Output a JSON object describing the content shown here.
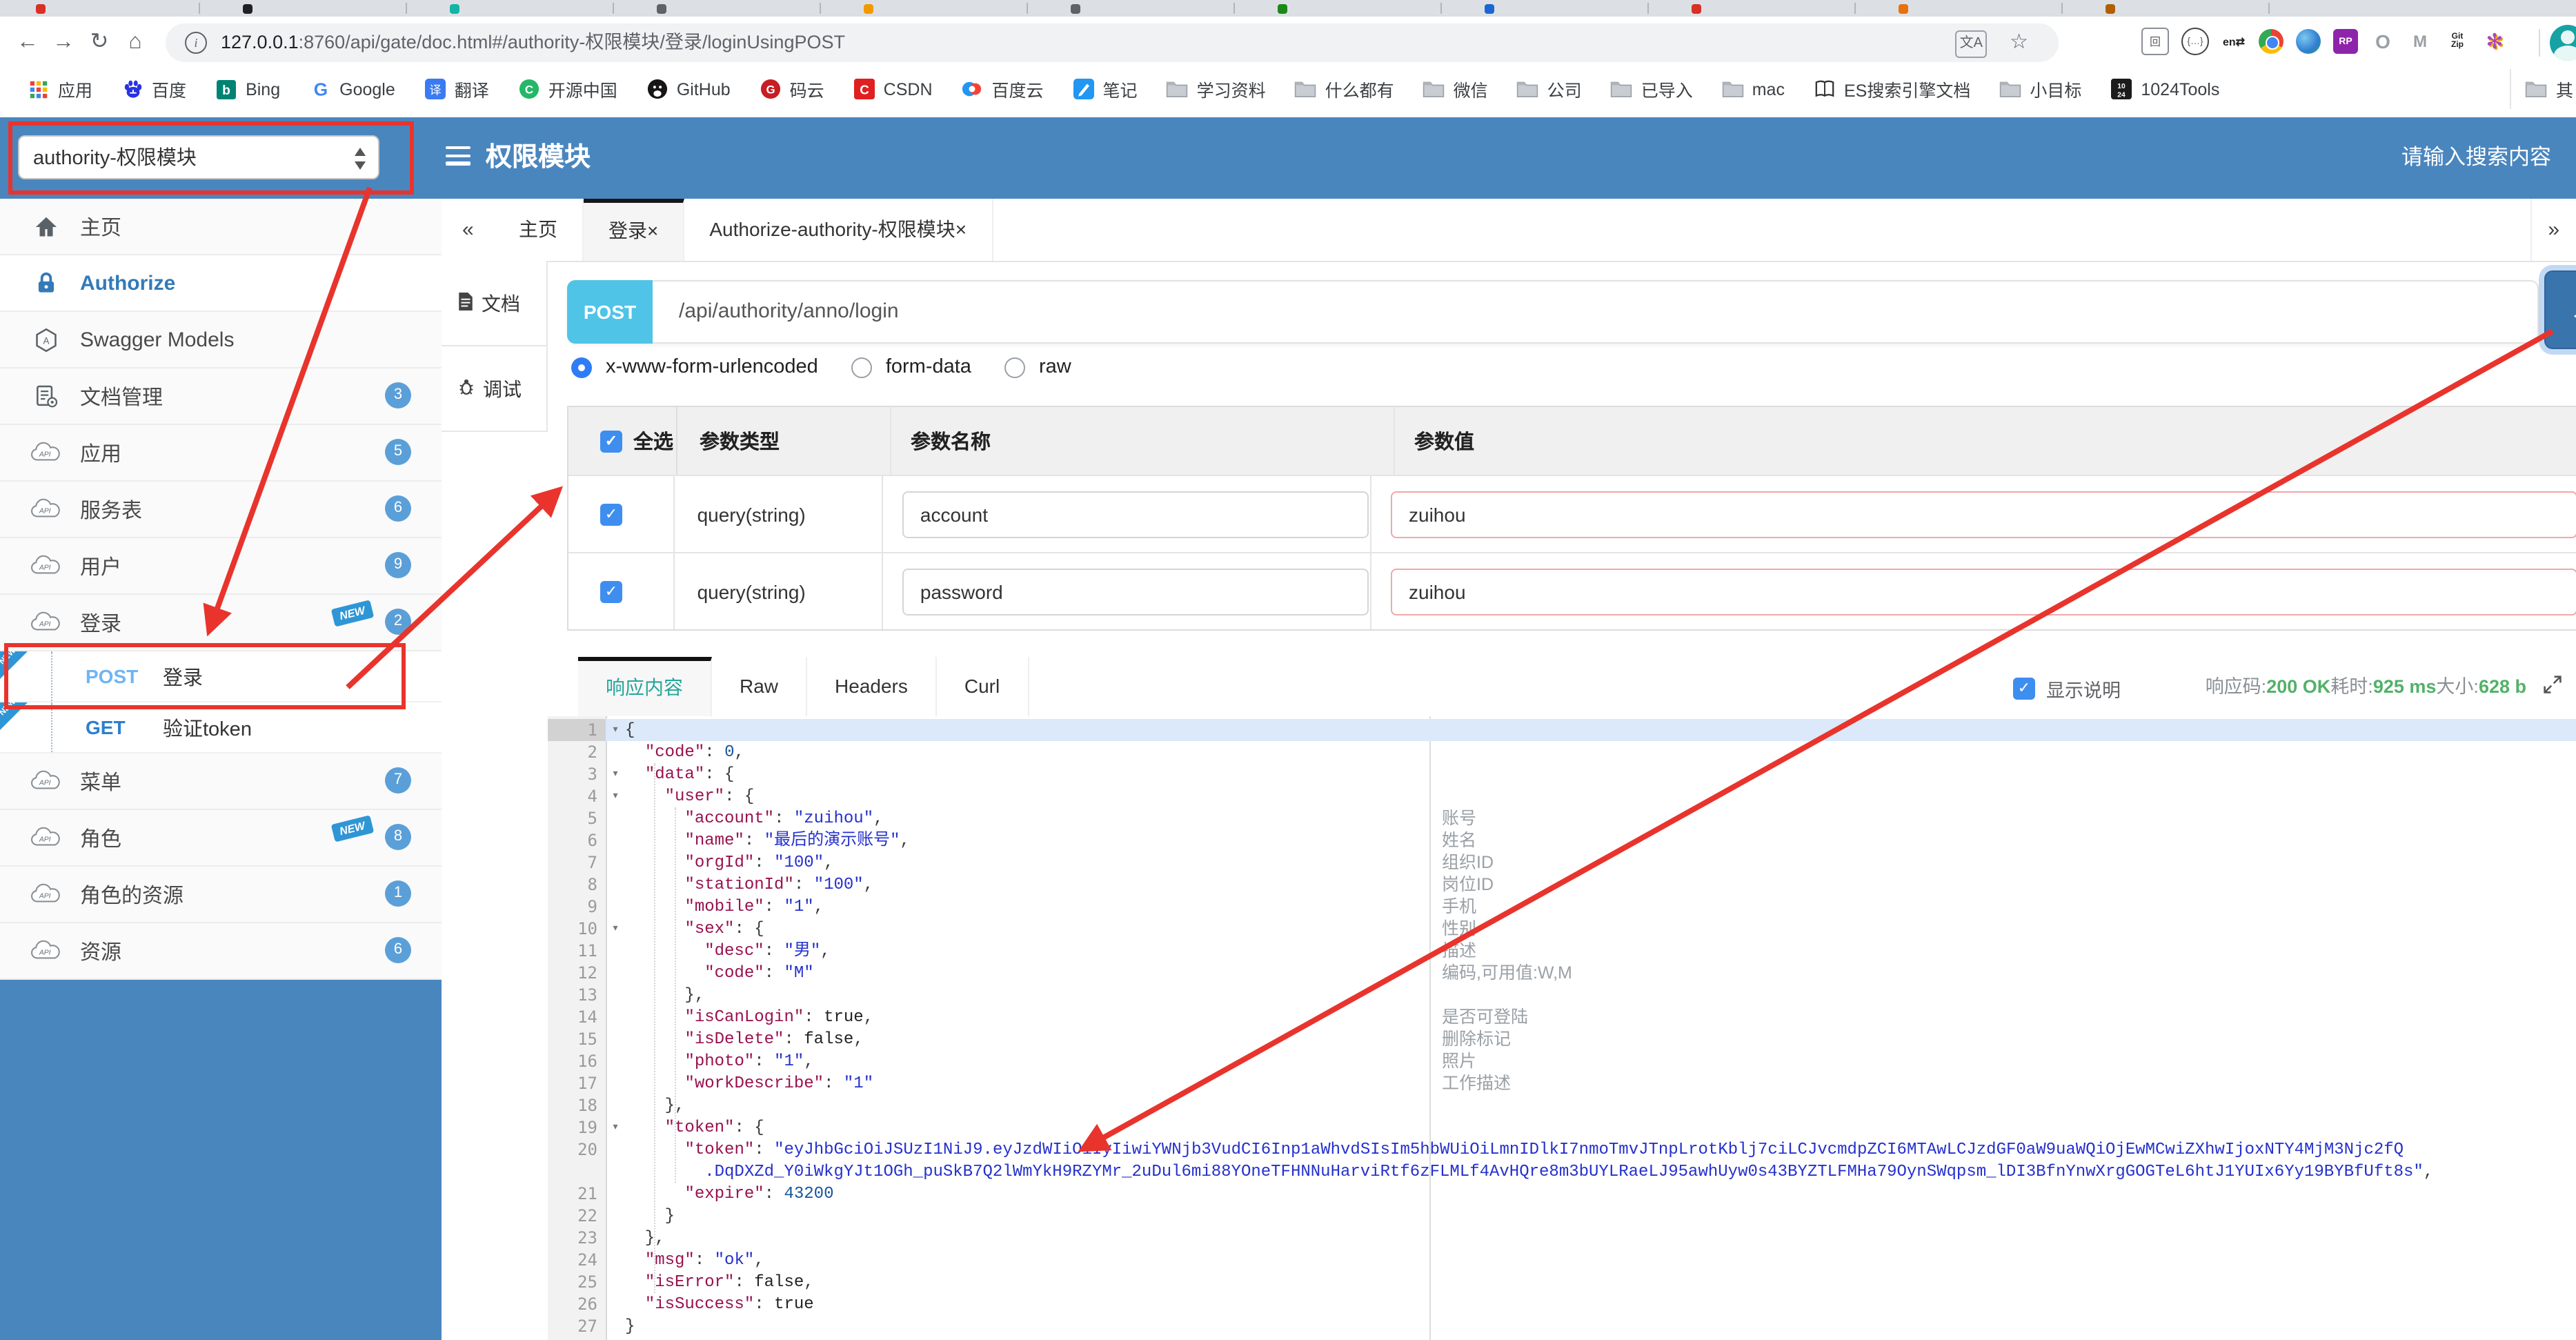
{
  "browser": {
    "tab_favicons": [
      "#d93025",
      "#202124",
      "#12b5a5",
      "#5f6368",
      "#f29900",
      "#5f6368",
      "#1a8917",
      "#1967d2",
      "#d93025",
      "#e8710a",
      "#b06000"
    ],
    "toolbar": {
      "back": "←",
      "forward": "→",
      "reload": "↻",
      "home": "⌂",
      "info": "i",
      "star": "☆",
      "translate": "文A",
      "url_host": "127.0.0.1",
      "url_rest": ":8760/api/gate/doc.html#/authority-权限模块/登录/loginUsingPOST"
    },
    "extensions": [
      "page",
      "braces",
      "en",
      "chrome",
      "globe",
      "rp",
      "o",
      "m",
      "gitzip",
      "asterisk"
    ],
    "bookmarks": [
      {
        "label": "应用",
        "icon": "apps"
      },
      {
        "label": "百度",
        "icon": "baidu"
      },
      {
        "label": "Bing",
        "icon": "bing"
      },
      {
        "label": "Google",
        "icon": "google"
      },
      {
        "label": "翻译",
        "icon": "translate"
      },
      {
        "label": "开源中国",
        "icon": "oschina"
      },
      {
        "label": "GitHub",
        "icon": "github"
      },
      {
        "label": "码云",
        "icon": "gitee"
      },
      {
        "label": "CSDN",
        "icon": "csdn"
      },
      {
        "label": "百度云",
        "icon": "baiduyun"
      },
      {
        "label": "笔记",
        "icon": "note"
      },
      {
        "label": "学习资料",
        "icon": "folder"
      },
      {
        "label": "什么都有",
        "icon": "folder"
      },
      {
        "label": "微信",
        "icon": "folder"
      },
      {
        "label": "公司",
        "icon": "folder"
      },
      {
        "label": "已导入",
        "icon": "folder"
      },
      {
        "label": "mac",
        "icon": "folder"
      },
      {
        "label": "ES搜索引擎文档",
        "icon": "book"
      },
      {
        "label": "小目标",
        "icon": "folder"
      },
      {
        "label": "1024Tools",
        "icon": "tools1024"
      }
    ],
    "bookmarks_overflow": "其"
  },
  "app": {
    "module_select": "authority-权限模块",
    "title": "权限模块",
    "search_placeholder": "请输入搜索内容"
  },
  "sidebar": {
    "items": [
      {
        "label": "主页",
        "icon": "home"
      },
      {
        "label": "Authorize",
        "icon": "lock",
        "accent": true
      },
      {
        "label": "Swagger Models",
        "icon": "models"
      },
      {
        "label": "文档管理",
        "icon": "docs",
        "badge": "3"
      },
      {
        "label": "应用",
        "icon": "api",
        "badge": "5"
      },
      {
        "label": "服务表",
        "icon": "api",
        "badge": "6"
      },
      {
        "label": "用户",
        "icon": "api",
        "badge": "9"
      },
      {
        "label": "登录",
        "icon": "api",
        "badge": "2",
        "tag": "NEW"
      },
      {
        "kind": "child",
        "method": "POST",
        "label": "登录",
        "ribbon": "NEW"
      },
      {
        "kind": "child",
        "method": "GET",
        "label": "验证token",
        "ribbon": "NEW"
      },
      {
        "label": "菜单",
        "icon": "api",
        "badge": "7"
      },
      {
        "label": "角色",
        "icon": "api",
        "badge": "8",
        "tag": "NEW"
      },
      {
        "label": "角色的资源",
        "icon": "api",
        "badge": "1"
      },
      {
        "label": "资源",
        "icon": "api",
        "badge": "6"
      }
    ]
  },
  "tabs": {
    "collapse": "«",
    "expand": "»",
    "close_glyph": "×",
    "home_label": "主页",
    "login_label": "登录×",
    "authorize_label": "Authorize-authority-权限模块×"
  },
  "doc_tabs": {
    "doc": "文档",
    "debug": "调试"
  },
  "endpoint": {
    "method": "POST",
    "path": "/api/authority/anno/login",
    "send_label": "发送"
  },
  "body_type": {
    "options": [
      {
        "label": "x-www-form-urlencoded",
        "selected": true
      },
      {
        "label": "form-data",
        "selected": false
      },
      {
        "label": "raw",
        "selected": false
      }
    ]
  },
  "params": {
    "headers": {
      "select_all": "全选",
      "type": "参数类型",
      "name": "参数名称",
      "value": "参数值"
    },
    "rows": [
      {
        "checked": true,
        "type": "query(string)",
        "name": "account",
        "value": "zuihou"
      },
      {
        "checked": true,
        "type": "query(string)",
        "name": "password",
        "value": "zuihou"
      }
    ]
  },
  "response": {
    "tab_content": "响应内容",
    "tab_raw": "Raw",
    "tab_headers": "Headers",
    "tab_curl": "Curl",
    "show_desc_label": "显示说明",
    "code_label": "响应码:",
    "code_value": "200 OK",
    "time_label": "耗时:",
    "time_value": "925 ms",
    "size_label": "大小:",
    "size_value": "628 b"
  },
  "code": {
    "lines": [
      {
        "n": "1",
        "f": true,
        "a": true,
        "t": [
          [
            "p",
            "{"
          ]
        ]
      },
      {
        "n": "2",
        "t": [
          [
            "p",
            "  "
          ],
          [
            "k",
            "\"code\""
          ],
          [
            "p",
            ": "
          ],
          [
            "n",
            "0"
          ],
          [
            "p",
            ","
          ]
        ]
      },
      {
        "n": "3",
        "f": true,
        "t": [
          [
            "p",
            "  "
          ],
          [
            "k",
            "\"data\""
          ],
          [
            "p",
            ": {"
          ]
        ]
      },
      {
        "n": "4",
        "f": true,
        "t": [
          [
            "p",
            "    "
          ],
          [
            "k",
            "\"user\""
          ],
          [
            "p",
            ": {"
          ]
        ]
      },
      {
        "n": "5",
        "c": "账号",
        "t": [
          [
            "p",
            "      "
          ],
          [
            "k",
            "\"account\""
          ],
          [
            "p",
            ": "
          ],
          [
            "s",
            "\"zuihou\""
          ],
          [
            "p",
            ","
          ]
        ]
      },
      {
        "n": "6",
        "c": "姓名",
        "t": [
          [
            "p",
            "      "
          ],
          [
            "k",
            "\"name\""
          ],
          [
            "p",
            ": "
          ],
          [
            "s",
            "\"最后的演示账号\""
          ],
          [
            "p",
            ","
          ]
        ]
      },
      {
        "n": "7",
        "c": "组织ID",
        "t": [
          [
            "p",
            "      "
          ],
          [
            "k",
            "\"orgId\""
          ],
          [
            "p",
            ": "
          ],
          [
            "s",
            "\"100\""
          ],
          [
            "p",
            ","
          ]
        ]
      },
      {
        "n": "8",
        "c": "岗位ID",
        "t": [
          [
            "p",
            "      "
          ],
          [
            "k",
            "\"stationId\""
          ],
          [
            "p",
            ": "
          ],
          [
            "s",
            "\"100\""
          ],
          [
            "p",
            ","
          ]
        ]
      },
      {
        "n": "9",
        "c": "手机",
        "t": [
          [
            "p",
            "      "
          ],
          [
            "k",
            "\"mobile\""
          ],
          [
            "p",
            ": "
          ],
          [
            "s",
            "\"1\""
          ],
          [
            "p",
            ","
          ]
        ]
      },
      {
        "n": "10",
        "f": true,
        "c": "性别",
        "t": [
          [
            "p",
            "      "
          ],
          [
            "k",
            "\"sex\""
          ],
          [
            "p",
            ": {"
          ]
        ]
      },
      {
        "n": "11",
        "c": "描述",
        "t": [
          [
            "p",
            "        "
          ],
          [
            "k",
            "\"desc\""
          ],
          [
            "p",
            ": "
          ],
          [
            "s",
            "\"男\""
          ],
          [
            "p",
            ","
          ]
        ]
      },
      {
        "n": "12",
        "c": "编码,可用值:W,M",
        "t": [
          [
            "p",
            "        "
          ],
          [
            "k",
            "\"code\""
          ],
          [
            "p",
            ": "
          ],
          [
            "s",
            "\"M\""
          ]
        ]
      },
      {
        "n": "13",
        "t": [
          [
            "p",
            "      },"
          ]
        ]
      },
      {
        "n": "14",
        "c": "是否可登陆",
        "t": [
          [
            "p",
            "      "
          ],
          [
            "k",
            "\"isCanLogin\""
          ],
          [
            "p",
            ": "
          ],
          [
            "b",
            "true"
          ],
          [
            "p",
            ","
          ]
        ]
      },
      {
        "n": "15",
        "c": "删除标记",
        "t": [
          [
            "p",
            "      "
          ],
          [
            "k",
            "\"isDelete\""
          ],
          [
            "p",
            ": "
          ],
          [
            "b",
            "false"
          ],
          [
            "p",
            ","
          ]
        ]
      },
      {
        "n": "16",
        "c": "照片",
        "t": [
          [
            "p",
            "      "
          ],
          [
            "k",
            "\"photo\""
          ],
          [
            "p",
            ": "
          ],
          [
            "s",
            "\"1\""
          ],
          [
            "p",
            ","
          ]
        ]
      },
      {
        "n": "17",
        "c": "工作描述",
        "t": [
          [
            "p",
            "      "
          ],
          [
            "k",
            "\"workDescribe\""
          ],
          [
            "p",
            ": "
          ],
          [
            "s",
            "\"1\""
          ]
        ]
      },
      {
        "n": "18",
        "t": [
          [
            "p",
            "    },"
          ]
        ]
      },
      {
        "n": "19",
        "f": true,
        "t": [
          [
            "p",
            "    "
          ],
          [
            "k",
            "\"token\""
          ],
          [
            "p",
            ": {"
          ]
        ]
      },
      {
        "n": "20",
        "t": [
          [
            "p",
            "      "
          ],
          [
            "k",
            "\"token\""
          ],
          [
            "p",
            ": "
          ],
          [
            "s",
            "\"eyJhbGciOiJSUzI1NiJ9.eyJzdWIiOiIyIiwiYWNjb3VudCI6Inp1aWhvdSIsIm5hbWUiOiLmnIDlkI7nmoTmvJTnpLrotKblj7ciLCJvcmdpZCI6MTAwLCJzdGF0aW9uaWQiOjEwMCwiZXhwIjoxNTY4MjM3Njc2fQ"
          ]
        ]
      },
      {
        "n": "",
        "t": [
          [
            "s",
            "        .DqDXZd_Y0iWkgYJt1OGh_puSkB7Q2lWmYkH9RZYMr_2uDul6mi88YOneTFHNNuHarviRtf6zFLMLf4AvHQre8m3bUYLRaeLJ95awhUyw0s43BYZTLFMHa79OynSWqpsm_lDI3BfnYnwXrgGOGTeL6htJ1YUIx6Yy19BYBfUft8s\""
          ],
          [
            "p",
            ","
          ]
        ]
      },
      {
        "n": "21",
        "t": [
          [
            "p",
            "      "
          ],
          [
            "k",
            "\"expire\""
          ],
          [
            "p",
            ": "
          ],
          [
            "n",
            "43200"
          ]
        ]
      },
      {
        "n": "22",
        "t": [
          [
            "p",
            "    }"
          ]
        ]
      },
      {
        "n": "23",
        "t": [
          [
            "p",
            "  },"
          ]
        ]
      },
      {
        "n": "24",
        "t": [
          [
            "p",
            "  "
          ],
          [
            "k",
            "\"msg\""
          ],
          [
            "p",
            ": "
          ],
          [
            "s",
            "\"ok\""
          ],
          [
            "p",
            ","
          ]
        ]
      },
      {
        "n": "25",
        "t": [
          [
            "p",
            "  "
          ],
          [
            "k",
            "\"isError\""
          ],
          [
            "p",
            ": "
          ],
          [
            "b",
            "false"
          ],
          [
            "p",
            ","
          ]
        ]
      },
      {
        "n": "26",
        "t": [
          [
            "p",
            "  "
          ],
          [
            "k",
            "\"isSuccess\""
          ],
          [
            "p",
            ": "
          ],
          [
            "b",
            "true"
          ]
        ]
      },
      {
        "n": "27",
        "t": [
          [
            "p",
            "}"
          ]
        ]
      }
    ]
  },
  "colors": {
    "header_blue": "#4a86be",
    "method_post_badge": "#4fc4e6",
    "success_green": "#53b169",
    "annotation_red": "#e8342c"
  }
}
